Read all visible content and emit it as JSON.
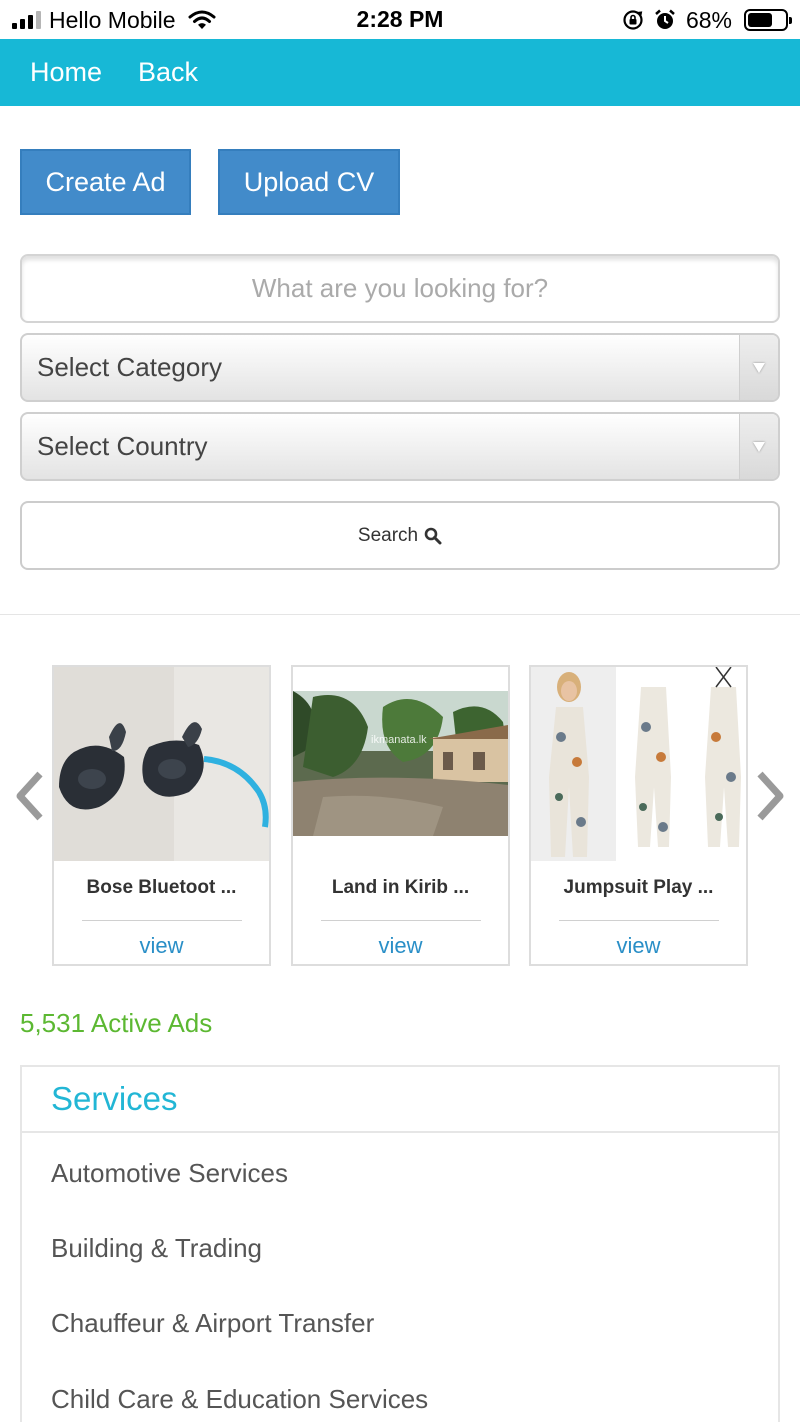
{
  "status_bar": {
    "carrier": "Hello Mobile",
    "time": "2:28 PM",
    "battery": "68%",
    "battery_level": 0.68
  },
  "nav": {
    "home": "Home",
    "back": "Back"
  },
  "actions": {
    "create_ad": "Create Ad",
    "upload_cv": "Upload CV"
  },
  "search": {
    "placeholder": "What are you looking for?",
    "category": "Select Category",
    "country": "Select Country",
    "button": "Search"
  },
  "carousel": {
    "items": [
      {
        "title": "Bose Bluetoot ...",
        "view": "view"
      },
      {
        "title": "Land in Kirib ...",
        "view": "view",
        "watermark": "ikmanata.lk"
      },
      {
        "title": "Jumpsuit Play ...",
        "view": "view"
      }
    ]
  },
  "active_ads": "5,531 Active Ads",
  "services": {
    "heading": "Services",
    "items": [
      "Automotive Services",
      "Building & Trading",
      "Chauffeur & Airport Transfer",
      "Child Care & Education Services"
    ]
  },
  "colors": {
    "nav_bg": "#17b8d6",
    "button_blue": "#428bca",
    "link_blue": "#2a8fc7",
    "active_green": "#5cb832",
    "heading_cyan": "#22b6d5"
  }
}
